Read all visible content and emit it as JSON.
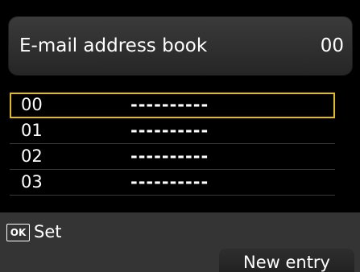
{
  "header": {
    "title": "E-mail address book",
    "count": "00"
  },
  "entries": [
    {
      "number": "00",
      "name": "----------",
      "selected": true
    },
    {
      "number": "01",
      "name": "----------",
      "selected": false
    },
    {
      "number": "02",
      "name": "----------",
      "selected": false
    },
    {
      "number": "03",
      "name": "----------",
      "selected": false
    }
  ],
  "footer": {
    "ok_key": "OK",
    "ok_label": "Set",
    "new_entry_label": "New entry"
  },
  "colors": {
    "selection": "#e6c000",
    "background": "#000000"
  }
}
